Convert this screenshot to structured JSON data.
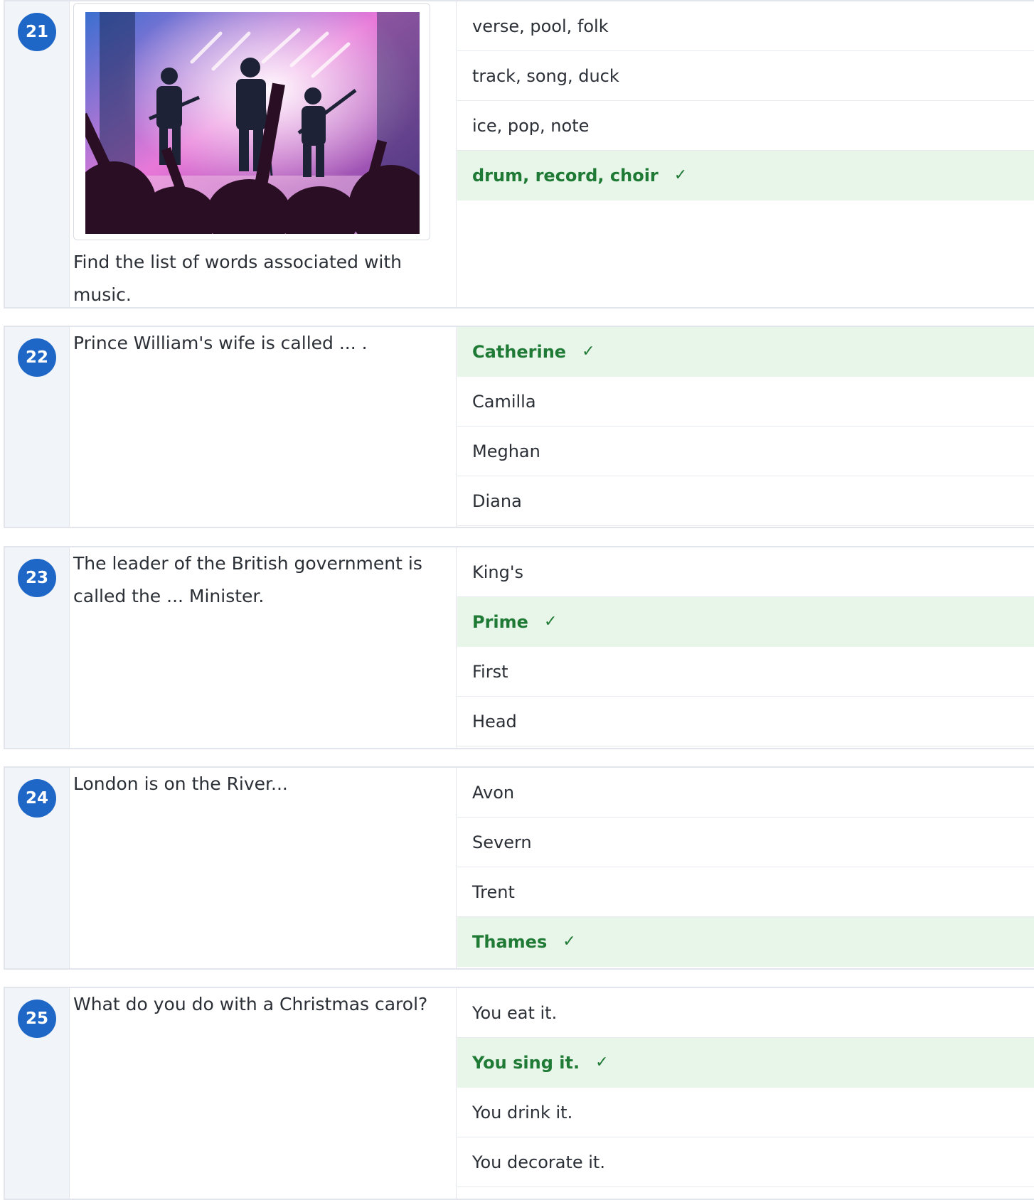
{
  "questions": [
    {
      "number": "21",
      "text": "Find the list of words associated with music.",
      "image": "concert-photo",
      "options": [
        {
          "label": "verse, pool, folk",
          "correct": false
        },
        {
          "label": "track, song, duck",
          "correct": false
        },
        {
          "label": "ice, pop, note",
          "correct": false
        },
        {
          "label": "drum, record, choir",
          "correct": true
        }
      ]
    },
    {
      "number": "22",
      "text": "Prince William's wife is called ... .",
      "options": [
        {
          "label": "Catherine",
          "correct": true
        },
        {
          "label": "Camilla",
          "correct": false
        },
        {
          "label": "Meghan",
          "correct": false
        },
        {
          "label": "Diana",
          "correct": false
        }
      ]
    },
    {
      "number": "23",
      "text": "The leader of the British government is called the ... Minister.",
      "options": [
        {
          "label": "King's",
          "correct": false
        },
        {
          "label": "Prime",
          "correct": true
        },
        {
          "label": "First",
          "correct": false
        },
        {
          "label": "Head",
          "correct": false
        }
      ]
    },
    {
      "number": "24",
      "text": "London is on the River...",
      "options": [
        {
          "label": "Avon",
          "correct": false
        },
        {
          "label": "Severn",
          "correct": false
        },
        {
          "label": "Trent",
          "correct": false
        },
        {
          "label": "Thames",
          "correct": true
        }
      ]
    },
    {
      "number": "25",
      "text": "What do you do with a Christmas carol?",
      "options": [
        {
          "label": "You eat it.",
          "correct": false
        },
        {
          "label": "You sing it.",
          "correct": true
        },
        {
          "label": "You drink it.",
          "correct": false
        },
        {
          "label": "You decorate it.",
          "correct": false
        }
      ]
    }
  ],
  "check_mark": "✓",
  "colors": {
    "badge": "#1f67c7",
    "correct_bg": "#e8f5e9",
    "correct_text": "#1f7a35",
    "gutter": "#f1f4f9"
  }
}
